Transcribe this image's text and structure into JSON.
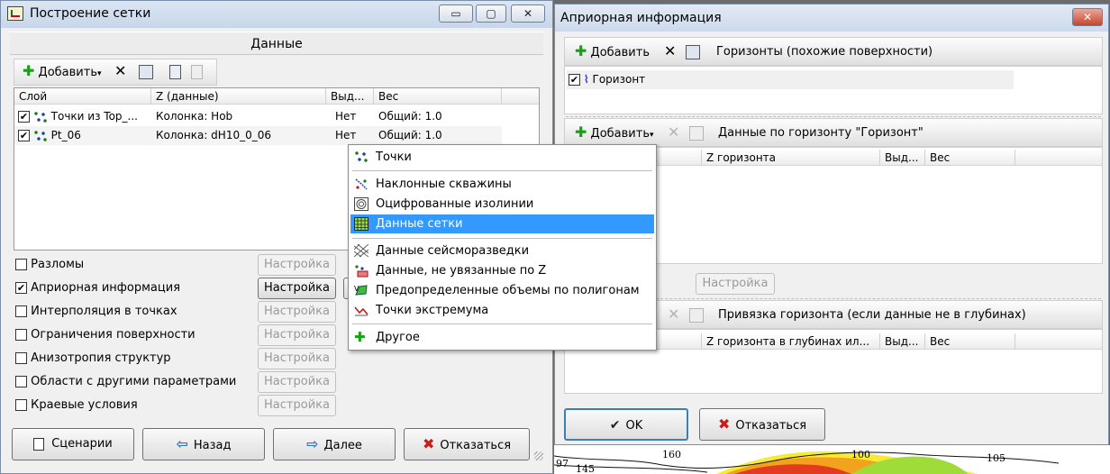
{
  "window1": {
    "title": "Построение сетки",
    "controls": {
      "minimize": "▭",
      "maximize": "▢",
      "close": "✕"
    },
    "panel_title": "Данные",
    "toolbar": {
      "add_label": "Добавить"
    },
    "columns": [
      "Слой",
      "Z (данные)",
      "Выд...",
      "Вес"
    ],
    "rows": [
      {
        "layer": "Точки из Top_...",
        "z": "Колонка: Hob",
        "sel": "Нет",
        "weight": "Общий: 1.0"
      },
      {
        "layer": "Pt_06",
        "z": "Колонка: dH10_0_06",
        "sel": "Нет",
        "weight": "Общий: 1.0"
      }
    ],
    "options": [
      {
        "label": "Разломы",
        "checked": false,
        "button": "Настройка",
        "enabled": false
      },
      {
        "label": "Априорная информация",
        "checked": true,
        "button": "Настройка",
        "enabled": true
      },
      {
        "label": "Интерполяция в точках",
        "checked": false,
        "button": "Настройка",
        "enabled": false
      },
      {
        "label": "Ограничения поверхности",
        "checked": false,
        "button": "Настройка",
        "enabled": false
      },
      {
        "label": "Анизотропия структур",
        "checked": false,
        "button": "Настройка",
        "enabled": false
      },
      {
        "label": "Области с другими параметрами",
        "checked": false,
        "button": "Настройка",
        "enabled": false
      },
      {
        "label": "Краевые условия",
        "checked": false,
        "button": "Настройка",
        "enabled": false
      }
    ],
    "buttons": {
      "scenarios": "Сценарии",
      "back": "Назад",
      "next": "Далее",
      "cancel": "Отказаться"
    }
  },
  "window2": {
    "title": "Априорная информация",
    "close": "✕",
    "section1": {
      "add_label": "Добавить",
      "title": "Горизонты (похожие поверхности)",
      "items": [
        {
          "label": "Горизонт",
          "checked": true
        }
      ]
    },
    "section2": {
      "add_label": "Добавить",
      "title": "Данные по горизонту \"Горизонт\"",
      "columns": [
        "Z горизонта",
        "Выд...",
        "Вес"
      ]
    },
    "settings_button": "Настройка",
    "section3": {
      "title": "Привязка горизонта (если данные не в глубинах)",
      "columns": [
        "Z горизонта в глубинах ил...",
        "Выд...",
        "Вес"
      ]
    },
    "ok": "OK",
    "cancel": "Отказаться"
  },
  "menu": {
    "items": [
      {
        "label": "Точки",
        "icon": "points-icon"
      },
      {
        "label": "Наклонные скважины",
        "icon": "wells-icon"
      },
      {
        "label": "Оцифрованные изолинии",
        "icon": "contours-icon"
      },
      {
        "label": "Данные сетки",
        "icon": "grid-icon",
        "selected": true
      },
      {
        "label": "Данные сейсморазведки",
        "icon": "seismic-icon"
      },
      {
        "label": "Данные, не увязанные по Z",
        "icon": "unbound-z-icon"
      },
      {
        "label": "Предопределенные объемы по полигонам",
        "icon": "polygon-volumes-icon"
      },
      {
        "label": "Точки экстремума",
        "icon": "extremum-icon"
      },
      {
        "label": "Другое",
        "icon": "plus-icon"
      }
    ]
  },
  "map": {
    "labels": [
      "160",
      "145",
      "97",
      "100",
      "105"
    ]
  },
  "colors": {
    "selection": "#3399ff",
    "plus_green": "#14a114",
    "cancel_red": "#d01818"
  }
}
